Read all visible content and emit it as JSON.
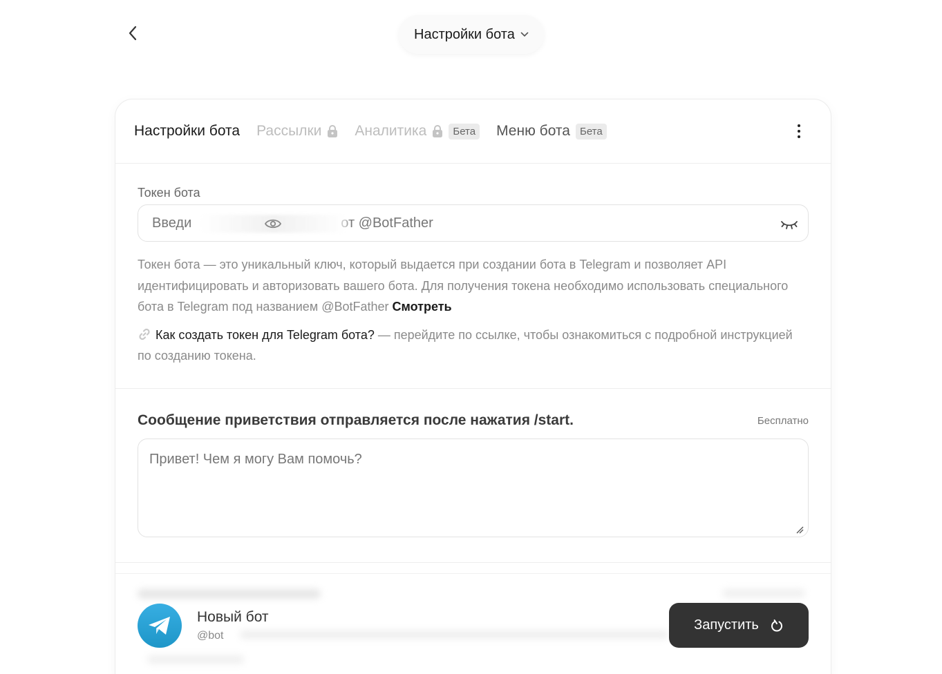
{
  "header": {
    "title": "Настройки бота"
  },
  "tabs": [
    {
      "label": "Настройки бота",
      "state": "active"
    },
    {
      "label": "Рассылки",
      "state": "locked"
    },
    {
      "label": "Аналитика",
      "state": "locked",
      "badge": "Бета"
    },
    {
      "label": "Меню бота",
      "state": "normal",
      "badge": "Бета"
    }
  ],
  "token": {
    "label": "Токен бота",
    "placeholder": "Введите токен от @BotFather",
    "visible_value": "Введи",
    "visible_suffix": "от @BotFather",
    "description": "Токен бота — это уникальный ключ, который выдается при создании бота в Telegram и позволяет API идентифицировать и авторизовать вашего бота. Для получения токена необходимо использовать специального бота в Telegram под названием @BotFather",
    "description_link": "Смотреть",
    "howto_link": "Как создать токен для Telegram бота?",
    "howto_text": " — перейдите по ссылке, чтобы ознакомиться с подробной инструкцией по созданию токена."
  },
  "welcome": {
    "title": "Сообщение приветствия отправляется после нажатия /start.",
    "price": "Бесплатно",
    "placeholder": "Привет! Чем я могу Вам помочь?"
  },
  "bot": {
    "name": "Новый бот",
    "handle": "@bot",
    "launch_label": "Запустить"
  },
  "colors": {
    "telegram_blue": "#2aa3dd",
    "button_dark": "#333333"
  }
}
